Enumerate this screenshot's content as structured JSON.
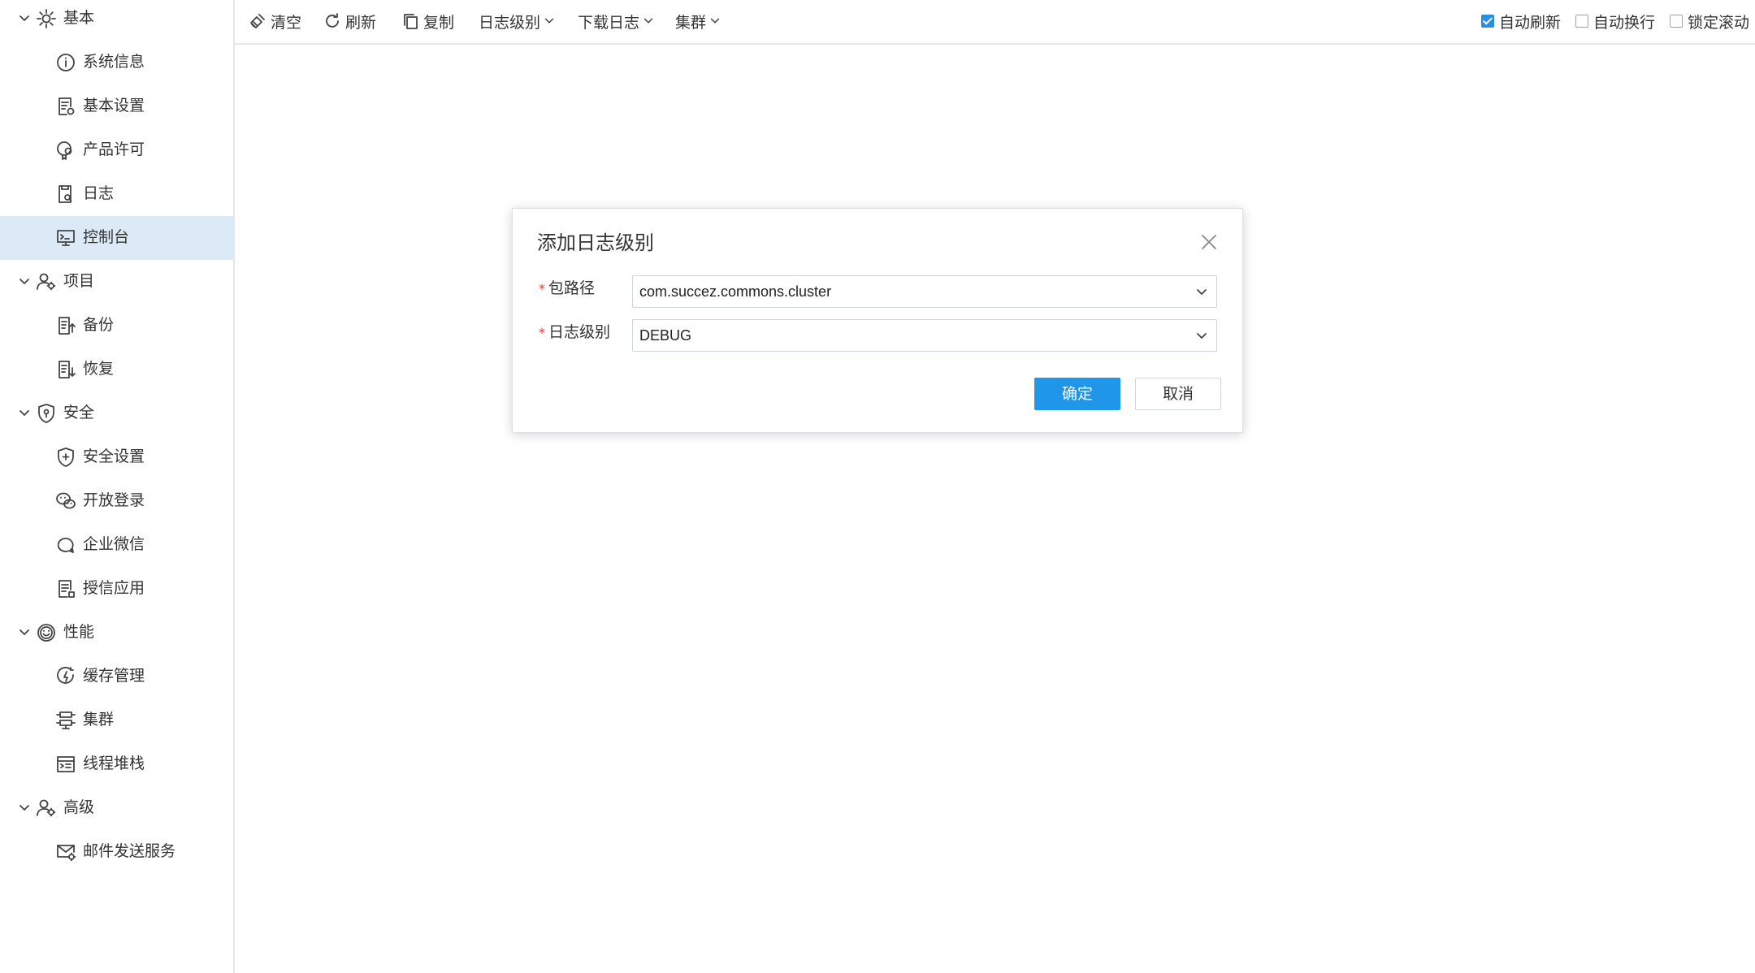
{
  "sidebar": {
    "groups": [
      {
        "label": "基本",
        "icon": "gear-icon",
        "items": [
          {
            "label": "系统信息",
            "icon": "info-icon"
          },
          {
            "label": "基本设置",
            "icon": "settings-doc-icon"
          },
          {
            "label": "产品许可",
            "icon": "license-icon"
          },
          {
            "label": "日志",
            "icon": "log-doc-icon"
          },
          {
            "label": "控制台",
            "icon": "console-icon",
            "active": true
          }
        ]
      },
      {
        "label": "项目",
        "icon": "project-users-icon",
        "items": [
          {
            "label": "备份",
            "icon": "backup-icon"
          },
          {
            "label": "恢复",
            "icon": "restore-icon"
          }
        ]
      },
      {
        "label": "安全",
        "icon": "shield-icon",
        "items": [
          {
            "label": "安全设置",
            "icon": "shield-plus-icon"
          },
          {
            "label": "开放登录",
            "icon": "wechat-icon"
          },
          {
            "label": "企业微信",
            "icon": "chat-bubble-icon"
          },
          {
            "label": "授信应用",
            "icon": "app-doc-icon"
          }
        ]
      },
      {
        "label": "性能",
        "icon": "smile-gauge-icon",
        "items": [
          {
            "label": "缓存管理",
            "icon": "cache-icon"
          },
          {
            "label": "集群",
            "icon": "cluster-icon"
          },
          {
            "label": "线程堆栈",
            "icon": "thread-stack-icon"
          }
        ]
      },
      {
        "label": "高级",
        "icon": "user-gear-icon",
        "items": [
          {
            "label": "邮件发送服务",
            "icon": "mail-gear-icon"
          }
        ]
      }
    ]
  },
  "toolbar": {
    "clear": "清空",
    "refresh": "刷新",
    "copy": "复制",
    "log_level": "日志级别",
    "download_log": "下载日志",
    "cluster": "集群",
    "auto_refresh": {
      "label": "自动刷新",
      "checked": true
    },
    "auto_wrap": {
      "label": "自动换行",
      "checked": false
    },
    "lock_scroll": {
      "label": "锁定滚动",
      "checked": false
    }
  },
  "dialog": {
    "title": "添加日志级别",
    "required_mark": "*",
    "package_label": "包路径",
    "package_value": "com.succez.commons.cluster",
    "level_label": "日志级别",
    "level_value": "DEBUG",
    "ok": "确定",
    "cancel": "取消"
  },
  "colors": {
    "accent": "#1f96e8",
    "active_bg": "#dceaf8",
    "required": "#e0353b"
  }
}
